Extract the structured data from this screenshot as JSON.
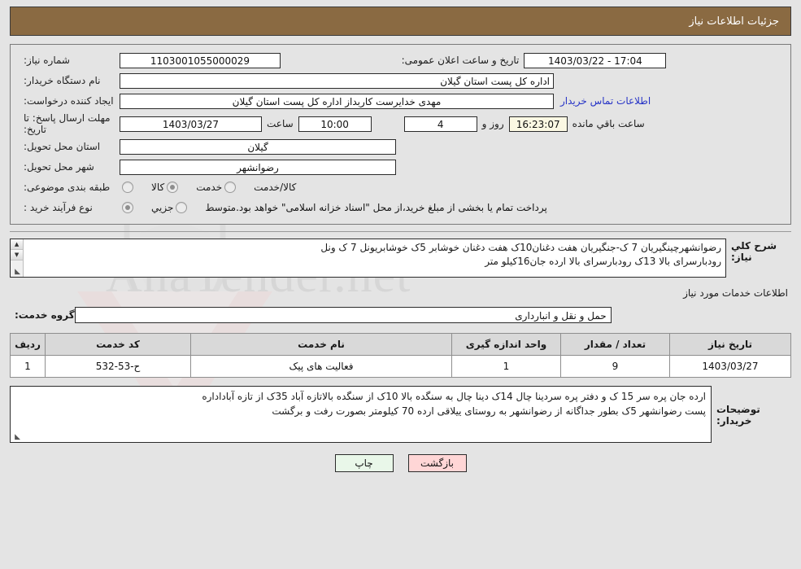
{
  "header": {
    "title": "جزئیات اطلاعات نیاز"
  },
  "form": {
    "need_number_label": "شماره نیاز:",
    "need_number_value": "1103001055000029",
    "public_announce_label": "تاریخ و ساعت اعلان عمومی:",
    "public_announce_value": "17:04 - 1403/03/22",
    "buyer_org_label": "نام دستگاه خریدار:",
    "buyer_org_value": "اداره کل پست استان گیلان",
    "creator_label": "ایجاد کننده درخواست:",
    "creator_value": "مهدی  خدایرست  کاربداز  اداره کل پست استان گیلان",
    "contact_link": "اطلاعات تماس خریدار",
    "deadline_label": "مهلت ارسال پاسخ: تا تاریخ:",
    "deadline_date": "1403/03/27",
    "deadline_hour_label": "ساعت",
    "deadline_hour": "10:00",
    "days_value": "4",
    "days_label": "روز و",
    "remaining_clock": "16:23:07",
    "remaining_label": "ساعت باقي مانده",
    "province_label": "استان محل تحویل:",
    "province_value": "گیلان",
    "city_label": "شهر محل تحویل:",
    "city_value": "رضوانشهر",
    "category_label": "طبقه بندی موضوعی:",
    "category_options": [
      {
        "label": "کالا",
        "selected": false
      },
      {
        "label": "خدمت",
        "selected": true
      },
      {
        "label": "کالا/خدمت",
        "selected": false
      }
    ],
    "process_label": "نوع فرآیند خرید :",
    "process_options": [
      {
        "label": "جزیي",
        "selected": true
      },
      {
        "label": "متوسط",
        "selected": false
      }
    ],
    "payment_note": "پرداخت تمام یا بخشی از مبلغ خرید،از محل \"اسناد خزانه اسلامی\" خواهد بود."
  },
  "description": {
    "label": "شرح کلي نیاز:",
    "value": "رضوانشهر‌چینگیریان 7 ک-جنگیریان هفت دغنان10ک هفت دغنان خوشابر 5ک خوشابریونل 7 ک ونل\nرودبارسرای بالا 13ک رودبارسرای بالا ارده جان16کیلو متر"
  },
  "services_section": {
    "heading": "اطلاعات خدمات مورد نیاز",
    "group_label": "گروه خدمت:",
    "group_value": "حمل و نقل و انبارداری"
  },
  "table": {
    "columns": [
      "ردیف",
      "کد خدمت",
      "نام خدمت",
      "واحد اندازه گیری",
      "تعداد / مقدار",
      "تاریخ نیاز"
    ],
    "rows": [
      {
        "radif": "1",
        "code": "ح-53-532",
        "name": "فعالیت های پیک",
        "unit": "1",
        "qty": "9",
        "date": "1403/03/27"
      }
    ]
  },
  "buyer_notes": {
    "label": "توضیحات خریدار:",
    "value": "ارده جان پره سر 15 ک و دفتر پره سردینا چال  14ک دینا چال به سنگده بالا  10ک از سنگده بالاتازه آباد 35ک از تازه آباداداره\nپست رضوانشهر 5ک بطور جداگانه از رضوانشهر به روستای ییلاقی ارده 70 کیلومتر بصورت رفت و برگشت"
  },
  "footer": {
    "print_label": "چاپ",
    "back_label": "بازگشت"
  },
  "watermark": {
    "text": "AnaTender.net"
  },
  "colors": {
    "header_bg": "#8a6a42",
    "page_bg": "#e4e4e4",
    "link": "#2633c6",
    "print_btn": "#e9f7e9",
    "back_btn": "#ffd6d6",
    "table_header": "#d9d9d9"
  }
}
